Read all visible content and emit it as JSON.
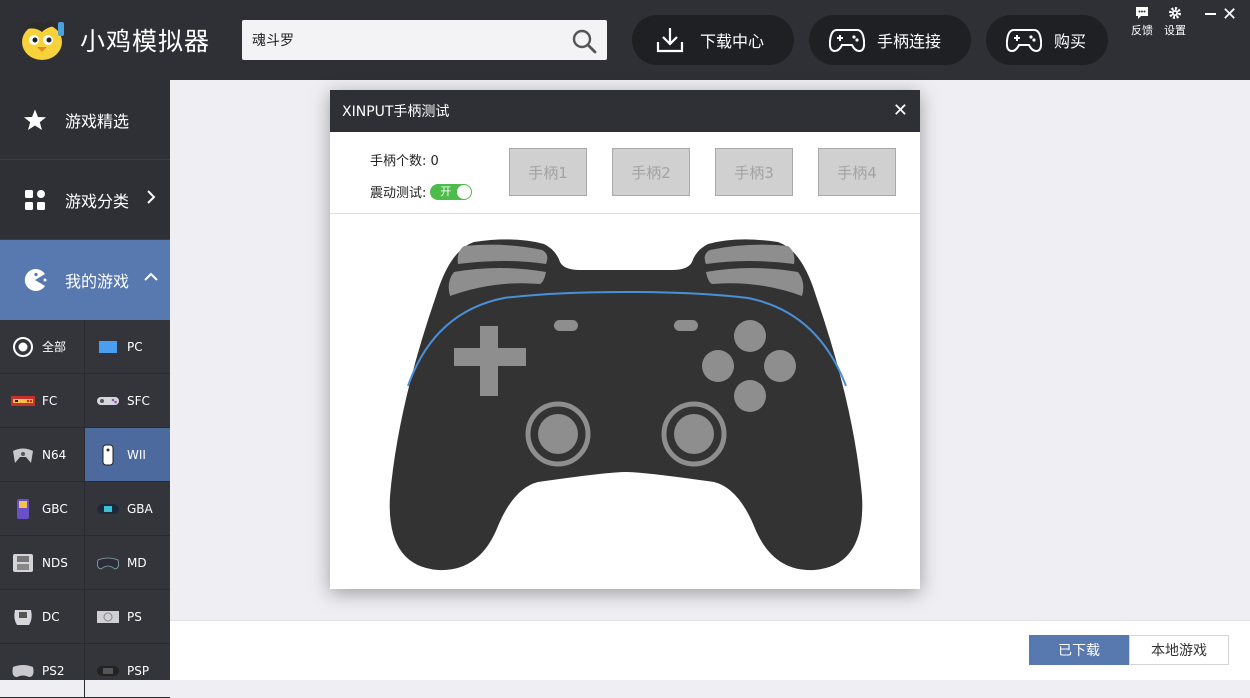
{
  "app": {
    "title": "小鸡模拟器"
  },
  "search": {
    "value": "魂斗罗"
  },
  "header": {
    "download_center": "下载中心",
    "controller_connect": "手柄连接",
    "buy": "购买",
    "feedback": "反馈",
    "settings": "设置"
  },
  "sidebar": {
    "featured": "游戏精选",
    "categories": "游戏分类",
    "my_games": "我的游戏",
    "platforms": [
      {
        "label": "全部",
        "icon": "radio-icon"
      },
      {
        "label": "PC",
        "icon": "pc-icon"
      },
      {
        "label": "FC",
        "icon": "fc-icon"
      },
      {
        "label": "SFC",
        "icon": "sfc-icon"
      },
      {
        "label": "N64",
        "icon": "n64-icon"
      },
      {
        "label": "WII",
        "icon": "wii-icon",
        "selected": true
      },
      {
        "label": "GBC",
        "icon": "gbc-icon"
      },
      {
        "label": "GBA",
        "icon": "gba-icon"
      },
      {
        "label": "NDS",
        "icon": "nds-icon"
      },
      {
        "label": "MD",
        "icon": "md-icon"
      },
      {
        "label": "DC",
        "icon": "dc-icon"
      },
      {
        "label": "PS",
        "icon": "ps-icon"
      },
      {
        "label": "PS2",
        "icon": "ps2-icon"
      },
      {
        "label": "PSP",
        "icon": "psp-icon"
      }
    ]
  },
  "bottom": {
    "downloaded": "已下载",
    "local_games": "本地游戏"
  },
  "dialog": {
    "title": "XINPUT手柄测试",
    "count_label": "手柄个数: 0",
    "vibration_label": "震动测试:",
    "vibration_state": "开",
    "pads": [
      "手柄1",
      "手柄2",
      "手柄3",
      "手柄4"
    ]
  },
  "colors": {
    "dark": "#2f3036",
    "accent": "#5878b0",
    "toggle_on": "#4cbd4a",
    "controller_body": "#333333",
    "controller_buttons": "#8e8e8e"
  }
}
